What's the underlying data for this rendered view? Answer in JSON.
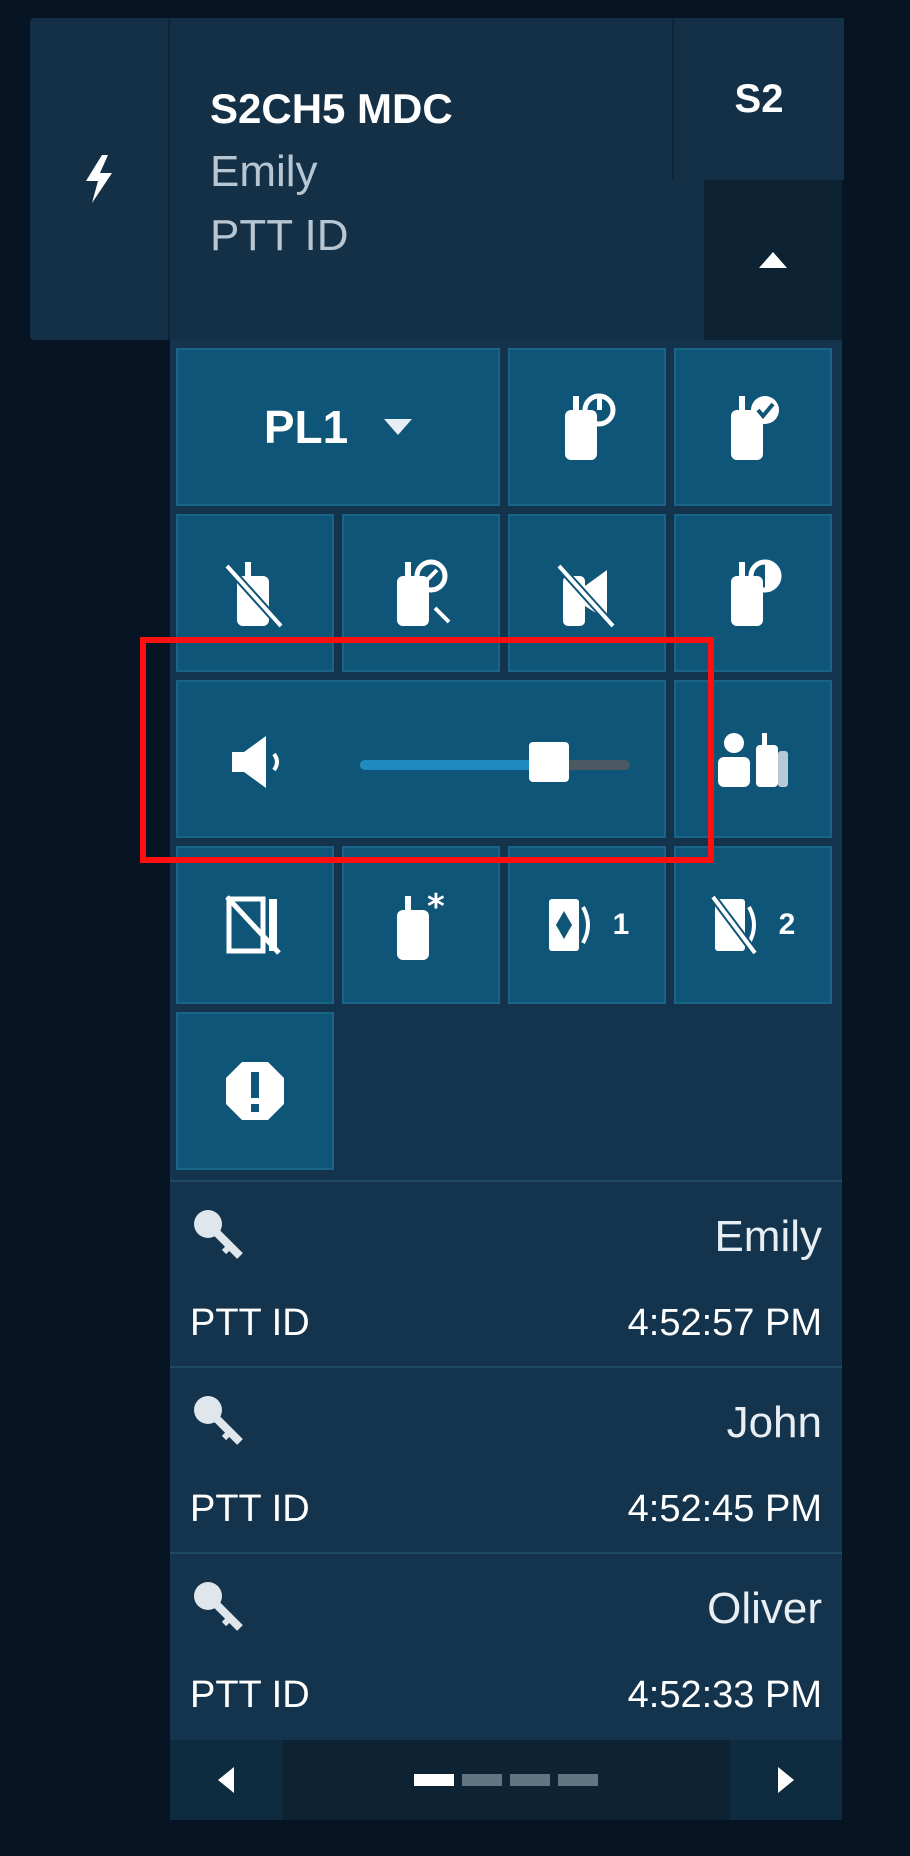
{
  "header": {
    "channel": "S2CH5 MDC",
    "user": "Emily",
    "ptt_label": "PTT ID",
    "side_tab": "S2",
    "icons": {
      "left": "bolt-icon",
      "collapse": "caret-up-icon"
    }
  },
  "controls": {
    "pl_select": {
      "value": "PL1"
    },
    "buttons": [
      {
        "icon": "radio-power-icon"
      },
      {
        "icon": "radio-check-icon"
      },
      {
        "icon": "radio-mute-icon"
      },
      {
        "icon": "radio-callback-icon"
      },
      {
        "icon": "speaker-muted-icon"
      },
      {
        "icon": "radio-monitor-icon"
      },
      {
        "icon": "patch-users-icon"
      },
      {
        "icon": "page-slash-icon"
      },
      {
        "icon": "radio-star-icon"
      },
      {
        "icon": "tone-1-icon",
        "badge": "1"
      },
      {
        "icon": "tone-2-icon",
        "badge": "2"
      },
      {
        "icon": "emergency-icon"
      }
    ],
    "volume": {
      "level": 0.7
    }
  },
  "history": [
    {
      "name": "Emily",
      "ptt": "PTT ID",
      "time": "4:52:57 PM"
    },
    {
      "name": "John",
      "ptt": "PTT ID",
      "time": "4:52:45 PM"
    },
    {
      "name": "Oliver",
      "ptt": "PTT ID",
      "time": "4:52:33 PM"
    }
  ],
  "pager": {
    "pages": 4,
    "active": 0
  },
  "colors": {
    "panel": "#13344c",
    "button": "#0f5578",
    "slider_fill": "#1e8cc0",
    "highlight": "#ff1010"
  }
}
